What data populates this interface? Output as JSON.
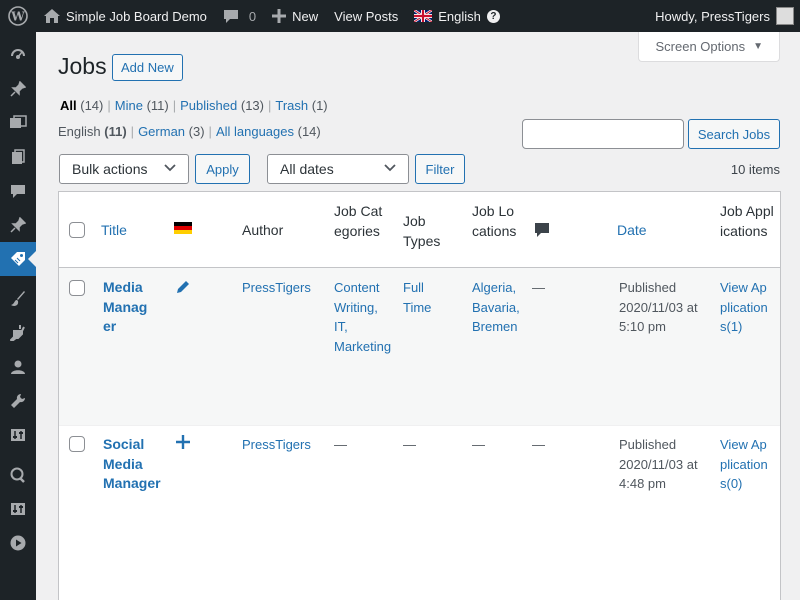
{
  "adminbar": {
    "site_name": "Simple Job Board Demo",
    "comments_count": "0",
    "new_label": "New",
    "view_posts": "View Posts",
    "language": "English",
    "greeting": "Howdy, PressTigers"
  },
  "screen_options": "Screen Options",
  "page": {
    "title": "Jobs",
    "add_new": "Add New"
  },
  "status_filters": [
    {
      "label": "All",
      "count": "(14)"
    },
    {
      "label": "Mine",
      "count": "(11)"
    },
    {
      "label": "Published",
      "count": "(13)"
    },
    {
      "label": "Trash",
      "count": "(1)"
    }
  ],
  "language_filters": [
    {
      "label": "English",
      "count": "(11)"
    },
    {
      "label": "German",
      "count": "(3)"
    },
    {
      "label": "All languages",
      "count": "(14)"
    }
  ],
  "search": {
    "placeholder": "",
    "button": "Search Jobs"
  },
  "toolbar": {
    "bulk_actions": "Bulk actions",
    "apply": "Apply",
    "dates": "All dates",
    "filter": "Filter",
    "items_count": "10 items"
  },
  "columns": {
    "title": "Title",
    "author": "Author",
    "categories": "Job Categories",
    "types": "Job Types",
    "locations": "Job Locations",
    "date": "Date",
    "applications": "Job Applications"
  },
  "rows": [
    {
      "title": "Media Manager",
      "author": "PressTigers",
      "categories": "Content Writing, IT, Marketing",
      "types": "Full Time",
      "locations": "Algeria, Bavaria, Bremen",
      "comments": "—",
      "status": "Published",
      "date": "2020/11/03 at 5:10 pm",
      "applications": "View Applications(1)"
    },
    {
      "title": "Social Media Manager",
      "author": "PressTigers",
      "categories": "—",
      "types": "—",
      "locations": "—",
      "comments": "—",
      "status": "Published",
      "date": "2020/11/03 at 4:48 pm",
      "applications": "View Applications(0)"
    }
  ],
  "colors": {
    "adminbar": "#1d2327",
    "accent": "#2271b1",
    "background": "#f0f0f1"
  }
}
